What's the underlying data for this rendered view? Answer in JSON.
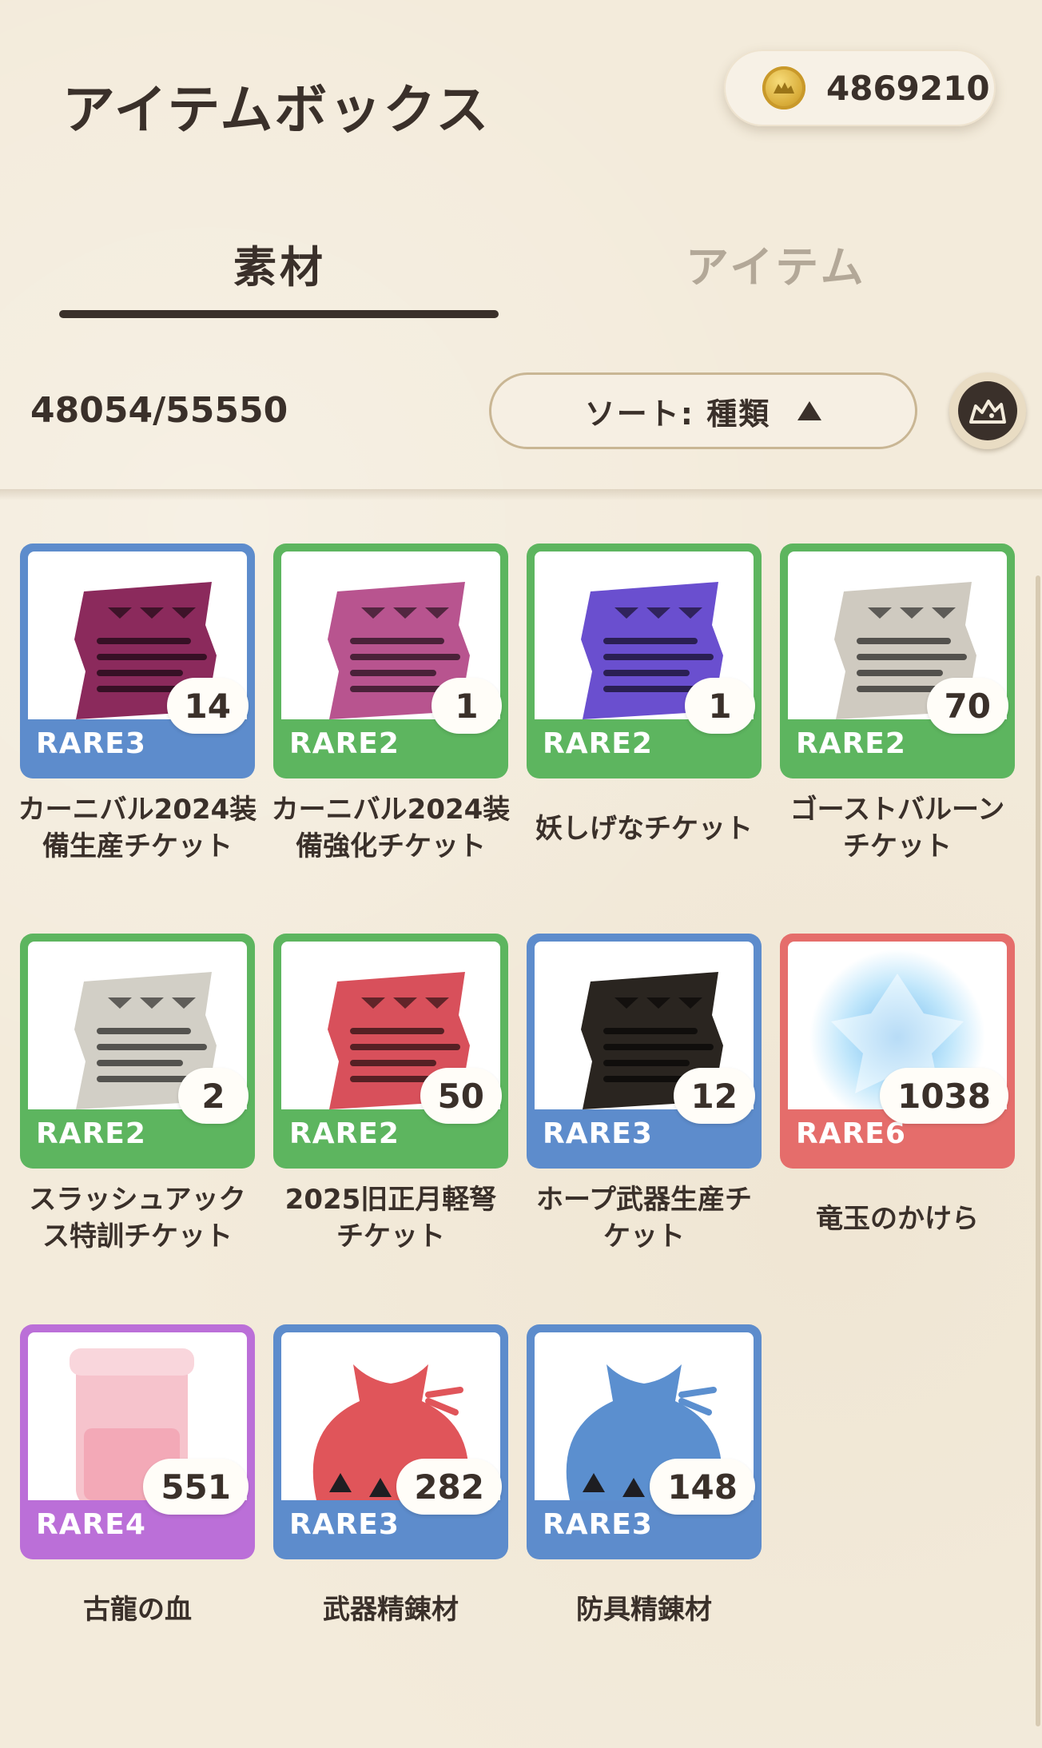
{
  "header": {
    "title": "アイテムボックス",
    "currency": "4869210"
  },
  "tabs": [
    {
      "label": "素材",
      "active": true
    },
    {
      "label": "アイテム",
      "active": false
    }
  ],
  "toolbar": {
    "count": "48054/55550",
    "sort_label": "ソート:  種類"
  },
  "items": [
    {
      "name_l1": "カーニバル2024装",
      "name_l2": "備生産チケット",
      "rarity": "RARE3",
      "qty": "14",
      "color": "#5d8ccc",
      "ticket": "#8b2a5c"
    },
    {
      "name_l1": "カーニバル2024装",
      "name_l2": "備強化チケット",
      "rarity": "RARE2",
      "qty": "1",
      "color": "#5db55f",
      "ticket": "#b8548f"
    },
    {
      "name_l1": "",
      "name_l2": "妖しげなチケット",
      "rarity": "RARE2",
      "qty": "1",
      "color": "#5db55f",
      "ticket": "#6a4fcf"
    },
    {
      "name_l1": "ゴーストバルーン",
      "name_l2": "チケット",
      "rarity": "RARE2",
      "qty": "70",
      "color": "#5db55f",
      "ticket": "#cfcac0"
    },
    {
      "name_l1": "スラッシュアック",
      "name_l2": "ス特訓チケット",
      "rarity": "RARE2",
      "qty": "2",
      "color": "#5db55f",
      "ticket": "#d2cfc6"
    },
    {
      "name_l1": "2025旧正月軽弩",
      "name_l2": "チケット",
      "rarity": "RARE2",
      "qty": "50",
      "color": "#5db55f",
      "ticket": "#d8505b"
    },
    {
      "name_l1": "ホープ武器生産チ",
      "name_l2": "ケット",
      "rarity": "RARE3",
      "qty": "12",
      "color": "#5d8ccc",
      "ticket": "#2a2520"
    },
    {
      "name_l1": "",
      "name_l2": "竜玉のかけら",
      "rarity": "RARE6",
      "qty": "1038",
      "color": "#e56d6b",
      "ticket": "#bfe6fb"
    },
    {
      "name_l1": "",
      "name_l2": "古龍の血",
      "rarity": "RARE4",
      "qty": "551",
      "color": "#bb6fd8",
      "ticket": "#f6c3cc"
    },
    {
      "name_l1": "",
      "name_l2": "武器精錬材",
      "rarity": "RARE3",
      "qty": "282",
      "color": "#5d8ccc",
      "ticket": "#e0555a"
    },
    {
      "name_l1": "",
      "name_l2": "防具精錬材",
      "rarity": "RARE3",
      "qty": "148",
      "color": "#5d8ccc",
      "ticket": "#5b8fcf"
    }
  ]
}
